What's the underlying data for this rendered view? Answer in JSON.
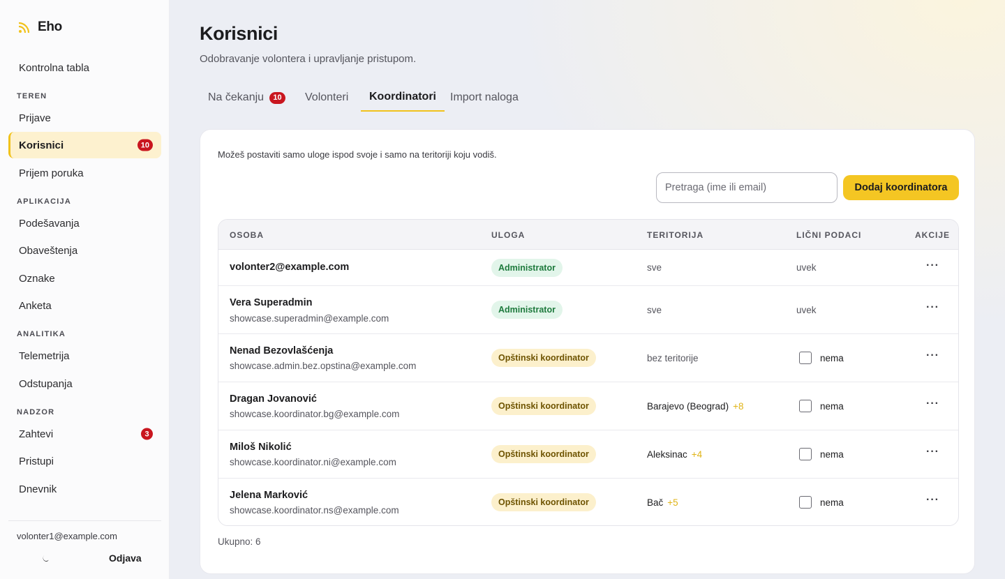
{
  "app": {
    "name": "Eho"
  },
  "sidebar": {
    "top": [
      {
        "label": "Kontrolna tabla"
      }
    ],
    "sections": {
      "teren": "TEREN",
      "aplikacija": "APLIKACIJA",
      "analitika": "ANALITIKA",
      "nadzor": "NADZOR"
    },
    "items": {
      "prijave": "Prijave",
      "korisnici": "Korisnici",
      "korisnici_badge": "10",
      "prijem_poruka": "Prijem poruka",
      "podesavanja": "Podešavanja",
      "obavestenja": "Obaveštenja",
      "oznake": "Oznake",
      "anketa": "Anketa",
      "telemetrija": "Telemetrija",
      "odstupanja": "Odstupanja",
      "zahtevi": "Zahtevi",
      "zahtevi_badge": "3",
      "pristupi": "Pristupi",
      "dnevnik": "Dnevnik"
    },
    "user_email": "volonter1@example.com",
    "logout_label": "Odjava",
    "theme_icon": "moon-icon"
  },
  "page": {
    "title": "Korisnici",
    "subtitle": "Odobravanje volontera i upravljanje pristupom."
  },
  "tabs": [
    {
      "label": "Na čekanju",
      "badge": "10",
      "active": false
    },
    {
      "label": "Volonteri",
      "active": false
    },
    {
      "label": "Koordinatori",
      "active": true
    },
    {
      "label": "Import naloga",
      "active": false
    }
  ],
  "panel": {
    "hint": "Možeš postaviti samo uloge ispod svoje i samo na teritoriji koju vodiš.",
    "search_placeholder": "Pretraga (ime ili email)",
    "add_button": "Dodaj koordinatora",
    "total": "Ukupno: 6"
  },
  "table": {
    "headers": {
      "osoba": "OSOBA",
      "uloga": "ULOGA",
      "teritorija": "TERITORIJA",
      "licni": "LIČNI PODACI",
      "akcije": "AKCIJE"
    },
    "rows": [
      {
        "name": "volonter2@example.com",
        "email": "",
        "role": "Administrator",
        "role_type": "admin",
        "territory": "sve",
        "territory_extra": "",
        "personal": "uvek",
        "personal_checkbox": false
      },
      {
        "name": "Vera Superadmin",
        "email": "showcase.superadmin@example.com",
        "role": "Administrator",
        "role_type": "admin",
        "territory": "sve",
        "territory_extra": "",
        "personal": "uvek",
        "personal_checkbox": false
      },
      {
        "name": "Nenad Bezovlašćenja",
        "email": "showcase.admin.bez.opstina@example.com",
        "role": "Opštinski koordinator",
        "role_type": "coord",
        "territory": "bez teritorije",
        "territory_extra": "",
        "personal": "nema",
        "personal_checkbox": true
      },
      {
        "name": "Dragan Jovanović",
        "email": "showcase.koordinator.bg@example.com",
        "role": "Opštinski koordinator",
        "role_type": "coord",
        "territory": "Barajevo (Beograd)",
        "territory_extra": "+8",
        "personal": "nema",
        "personal_checkbox": true
      },
      {
        "name": "Miloš Nikolić",
        "email": "showcase.koordinator.ni@example.com",
        "role": "Opštinski koordinator",
        "role_type": "coord",
        "territory": "Aleksinac",
        "territory_extra": "+4",
        "personal": "nema",
        "personal_checkbox": true
      },
      {
        "name": "Jelena Marković",
        "email": "showcase.koordinator.ns@example.com",
        "role": "Opštinski koordinator",
        "role_type": "coord",
        "territory": "Bač",
        "territory_extra": "+5",
        "personal": "nema",
        "personal_checkbox": true
      }
    ],
    "actions_label": "···"
  },
  "colors": {
    "accent": "#f4c623",
    "badge": "#c9161f",
    "admin_pill": "#e2f5ea",
    "coord_pill": "#fcf0cc"
  }
}
